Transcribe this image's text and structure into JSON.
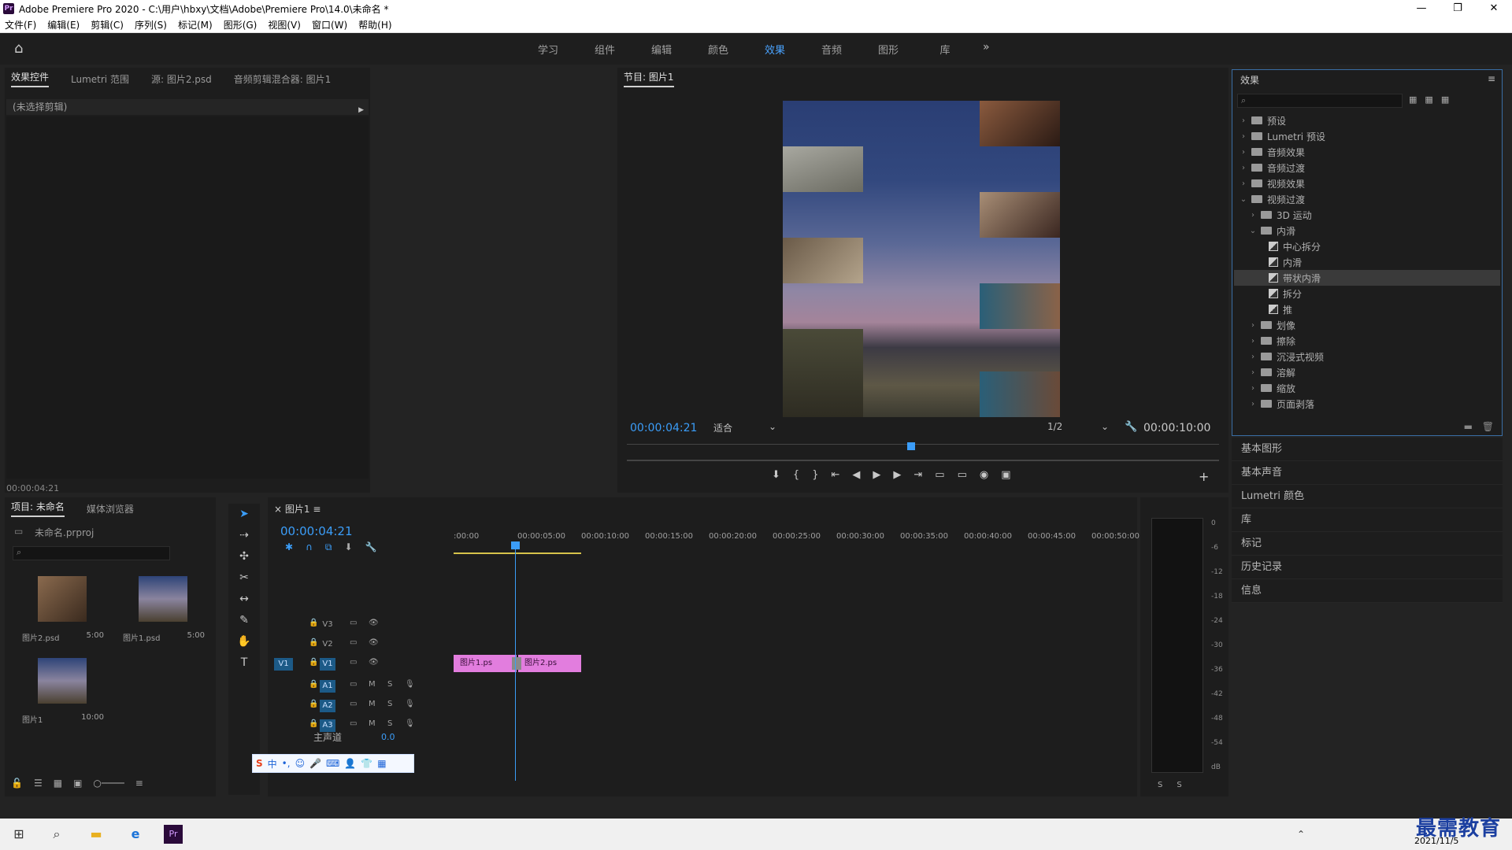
{
  "window": {
    "app_logo": "Pr",
    "title": "Adobe Premiere Pro 2020 - C:\\用户\\hbxy\\文档\\Adobe\\Premiere Pro\\14.0\\未命名 *",
    "minimize": "—",
    "maximize": "❐",
    "close": "✕"
  },
  "menu": [
    "文件(F)",
    "编辑(E)",
    "剪辑(C)",
    "序列(S)",
    "标记(M)",
    "图形(G)",
    "视图(V)",
    "窗口(W)",
    "帮助(H)"
  ],
  "workspaces": {
    "tabs": [
      "学习",
      "组件",
      "编辑",
      "颜色",
      "效果",
      "音频",
      "图形",
      "库"
    ],
    "active": "效果",
    "more": "»"
  },
  "effect_controls": {
    "tabs": [
      "效果控件",
      "Lumetri 范围",
      "源: 图片2.psd",
      "音频剪辑混合器: 图片1"
    ],
    "no_clip": "(未选择剪辑)",
    "timecode": "00:00:04:21"
  },
  "program_monitor": {
    "title": "节目: 图片1",
    "current_time": "00:00:04:21",
    "fit": "适合",
    "resolution": "1/2",
    "duration": "00:00:10:00",
    "playhead_fraction": 0.48
  },
  "effects_panel": {
    "title": "效果",
    "search_placeholder": "",
    "tree": [
      {
        "label": "预设",
        "level": 0,
        "type": "folder",
        "open": false
      },
      {
        "label": "Lumetri 预设",
        "level": 0,
        "type": "folder",
        "open": false
      },
      {
        "label": "音频效果",
        "level": 0,
        "type": "folder",
        "open": false
      },
      {
        "label": "音频过渡",
        "level": 0,
        "type": "folder",
        "open": false
      },
      {
        "label": "视频效果",
        "level": 0,
        "type": "folder",
        "open": false
      },
      {
        "label": "视频过渡",
        "level": 0,
        "type": "folder",
        "open": true
      },
      {
        "label": "3D 运动",
        "level": 1,
        "type": "folder",
        "open": false
      },
      {
        "label": "内滑",
        "level": 1,
        "type": "folder",
        "open": true
      },
      {
        "label": "中心拆分",
        "level": 2,
        "type": "effect"
      },
      {
        "label": "内滑",
        "level": 2,
        "type": "effect"
      },
      {
        "label": "带状内滑",
        "level": 2,
        "type": "effect",
        "selected": true
      },
      {
        "label": "拆分",
        "level": 2,
        "type": "effect"
      },
      {
        "label": "推",
        "level": 2,
        "type": "effect"
      },
      {
        "label": "划像",
        "level": 1,
        "type": "folder",
        "open": false
      },
      {
        "label": "擦除",
        "level": 1,
        "type": "folder",
        "open": false
      },
      {
        "label": "沉浸式视频",
        "level": 1,
        "type": "folder",
        "open": false
      },
      {
        "label": "溶解",
        "level": 1,
        "type": "folder",
        "open": false
      },
      {
        "label": "缩放",
        "level": 1,
        "type": "folder",
        "open": false
      },
      {
        "label": "页面剥落",
        "level": 1,
        "type": "folder",
        "open": false
      }
    ]
  },
  "side_panels": [
    "基本图形",
    "基本声音",
    "Lumetri 颜色",
    "库",
    "标记",
    "历史记录",
    "信息"
  ],
  "project": {
    "tabs": [
      "项目: 未命名",
      "媒体浏览器"
    ],
    "file": "未命名.prproj",
    "items": [
      {
        "name": "图片2.psd",
        "duration": "5:00"
      },
      {
        "name": "图片1.psd",
        "duration": "5:00"
      },
      {
        "name": "图片1",
        "duration": "10:00"
      }
    ]
  },
  "tools": [
    "selection-tool",
    "track-select-tool",
    "ripple-edit-tool",
    "razor-tool",
    "slip-tool",
    "pen-tool",
    "hand-tool",
    "type-tool"
  ],
  "timeline": {
    "title": "图片1",
    "current_time": "00:00:04:21",
    "ruler": [
      ":00:00",
      "00:00:05:00",
      "00:00:10:00",
      "00:00:15:00",
      "00:00:20:00",
      "00:00:25:00",
      "00:00:30:00",
      "00:00:35:00",
      "00:00:40:00",
      "00:00:45:00",
      "00:00:50:00"
    ],
    "video_tracks": [
      "V3",
      "V2",
      "V1"
    ],
    "audio_tracks": [
      "A1",
      "A2",
      "A3"
    ],
    "source_patch": "V1",
    "master_label": "主声道",
    "master_value": "0.0",
    "clips": [
      {
        "name": "图片1.ps",
        "track": "V1"
      },
      {
        "name": "图片2.ps",
        "track": "V1"
      }
    ],
    "mute_label": "M",
    "solo_label": "S"
  },
  "meters": {
    "scale": [
      "0",
      "-6",
      "-12",
      "-18",
      "-24",
      "-30",
      "-36",
      "-42",
      "-48",
      "-54",
      "dB"
    ],
    "solo": [
      "S",
      "S"
    ]
  },
  "taskbar": {
    "date": "2021/11/5"
  },
  "watermark": "最需教育"
}
